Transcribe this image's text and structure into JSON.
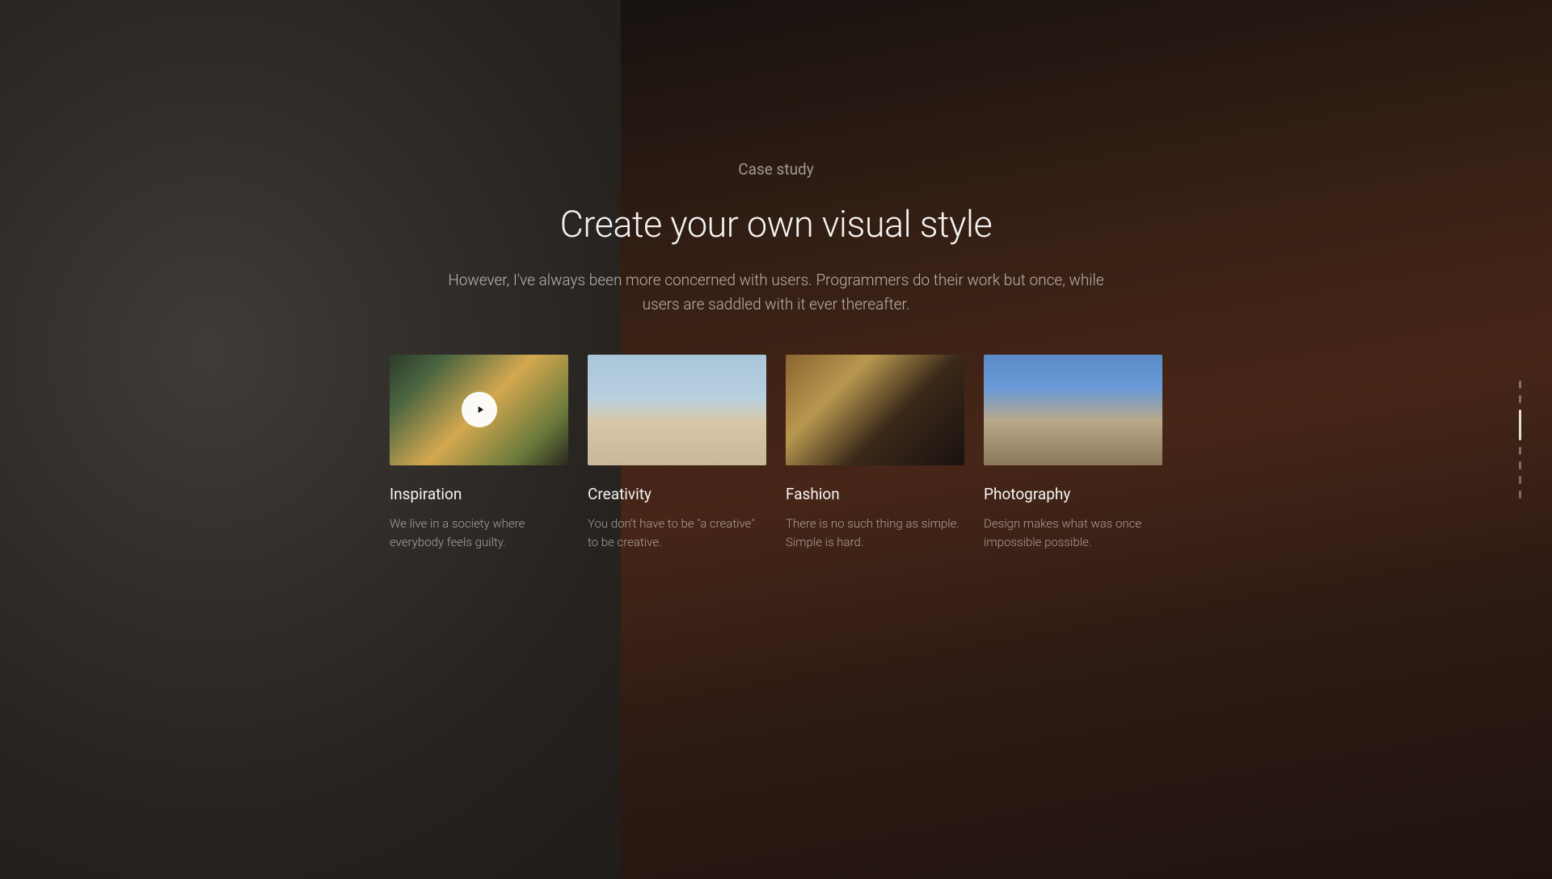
{
  "header": {
    "eyebrow": "Case study",
    "headline": "Create your own visual style",
    "subtext": "However, I've always been more concerned with users. Programmers do their work but once, while users are saddled with it ever thereafter."
  },
  "cards": [
    {
      "title": "Inspiration",
      "description": "We live in a society where everybody feels guilty.",
      "has_play": true
    },
    {
      "title": "Creativity",
      "description": "You don't have to be \"a creative\" to be creative.",
      "has_play": false
    },
    {
      "title": "Fashion",
      "description": "There is no such thing as simple. Simple is hard.",
      "has_play": false
    },
    {
      "title": "Photography",
      "description": "Design makes what was once impossible possible.",
      "has_play": false
    }
  ],
  "scroll": {
    "total": 7,
    "active_index": 2
  }
}
